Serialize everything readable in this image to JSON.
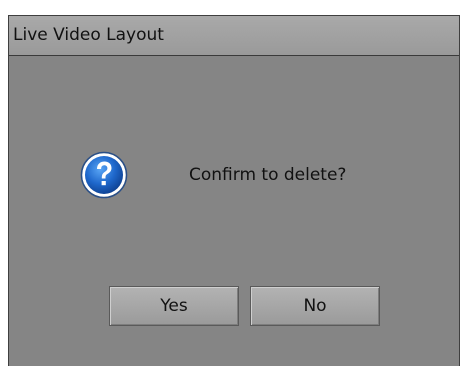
{
  "window": {
    "title": "Live Video Layout"
  },
  "dialog": {
    "icon": "question-icon",
    "message": "Confirm to delete?",
    "yes_label": "Yes",
    "no_label": "No"
  },
  "colors": {
    "background": "#858585",
    "titlebar": "#a3a3a3",
    "icon_blue": "#1e67c9",
    "text": "#111111"
  }
}
